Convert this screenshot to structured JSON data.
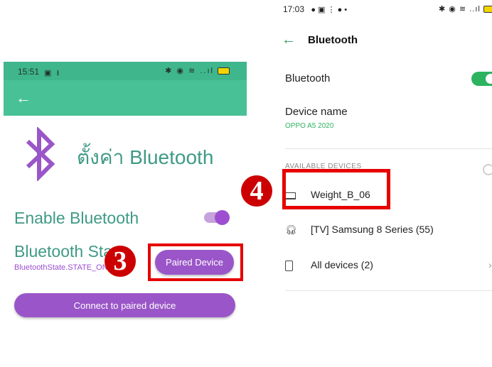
{
  "left_screen": {
    "status_time": "15:51",
    "status_left_icons": "▣ ⭳",
    "status_right_icons": "✱ ◉ ≋ ..ıl",
    "back_icon": "arrow-left-icon",
    "title": "ตั้งค่า Bluetooth",
    "enable_label": "Enable Bluetooth",
    "enable_on": true,
    "state_title": "Bluetooth State",
    "state_value": "BluetoothState.STATE_ON",
    "paired_button": "Paired Device",
    "connect_button": "Connect to paired device",
    "step_badge": "3",
    "colors": {
      "status": "#3fb68b",
      "appbar": "#49c196",
      "accent": "#9a56c8",
      "text": "#3f9a86"
    }
  },
  "right_screen": {
    "status_time": "17:03",
    "status_left_icons": "● ▣ ⋮ ● •",
    "status_right_icons": "✱ ◉ ≋ ..ıl",
    "back_icon": "arrow-left-icon",
    "title": "Bluetooth",
    "bluetooth_label": "Bluetooth",
    "bluetooth_on": true,
    "device_name_label": "Device name",
    "device_name_value": "OPPO A5 2020",
    "section_label": "AVAILABLE DEVICES",
    "devices": [
      {
        "icon": "laptop-icon",
        "name": "Weight_B_06"
      },
      {
        "icon": "headphones-icon",
        "name": "[TV] Samsung 8 Series (55)"
      },
      {
        "icon": "tablet-icon",
        "name": "All devices (2)"
      }
    ],
    "step_badge": "4",
    "colors": {
      "accent": "#2cb35f",
      "highlight": "#e60000"
    }
  }
}
